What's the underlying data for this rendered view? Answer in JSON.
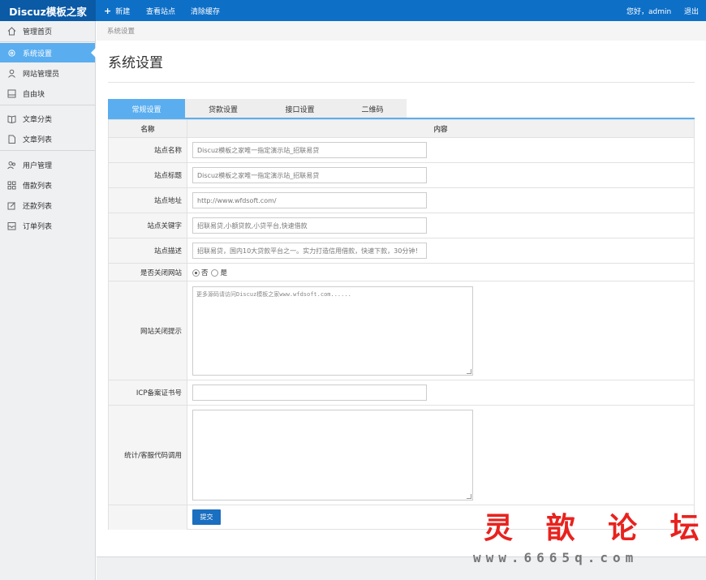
{
  "topbar": {
    "logo": "Discuz模板之家",
    "nav": {
      "new_label": "新建",
      "view_site_label": "查看站点",
      "clear_cache_label": "清除缓存"
    },
    "greeting": "您好，admin",
    "logout_label": "退出"
  },
  "sidebar": {
    "items": [
      {
        "label": "管理首页",
        "icon": "home-icon"
      },
      {
        "label": "系统设置",
        "icon": "gear-icon",
        "active": true
      },
      {
        "label": "网站管理员",
        "icon": "user-icon"
      },
      {
        "label": "自由块",
        "icon": "block-icon"
      },
      {
        "label": "文章分类",
        "icon": "book-icon"
      },
      {
        "label": "文章列表",
        "icon": "document-icon"
      },
      {
        "label": "用户管理",
        "icon": "users-icon"
      },
      {
        "label": "借款列表",
        "icon": "grid-icon"
      },
      {
        "label": "还款列表",
        "icon": "edit-icon"
      },
      {
        "label": "订单列表",
        "icon": "inbox-icon"
      }
    ]
  },
  "breadcrumb": "系统设置",
  "page_title": "系统设置",
  "tabs": [
    {
      "label": "常规设置",
      "active": true
    },
    {
      "label": "贷款设置"
    },
    {
      "label": "接口设置"
    },
    {
      "label": "二维码"
    }
  ],
  "table": {
    "header_name": "名称",
    "header_content": "内容",
    "fields": {
      "site_name": {
        "label": "站点名称",
        "value": "Discuz模板之家唯一指定演示站_招联易贷"
      },
      "site_title": {
        "label": "站点标题",
        "value": "Discuz模板之家唯一指定演示站_招联易贷"
      },
      "site_url": {
        "label": "站点地址",
        "value": "http://www.wfdsoft.com/"
      },
      "site_keywords": {
        "label": "站点关键字",
        "value": "招联易贷,小额贷款,小贷平台,快速借款"
      },
      "site_description": {
        "label": "站点描述",
        "value": "招联易贷，国内10大贷款平台之一。实力打造信用借款，快速下款，30分钟！"
      },
      "close_site": {
        "label": "是否关闭网站",
        "option_no": "否",
        "option_yes": "是",
        "selected": "否"
      },
      "close_notice": {
        "label": "网站关闭提示",
        "value": "更多源码请访问Discuz模板之家www.wfdsoft.com......"
      },
      "icp": {
        "label": "ICP备案证书号",
        "value": ""
      },
      "stats_code": {
        "label": "统计/客服代码调用",
        "value": ""
      }
    },
    "submit_label": "提交"
  },
  "watermark": {
    "title": "灵 歆 论 坛",
    "url": "www.6665q.com",
    "color": "#e8221e"
  },
  "colors": {
    "topbar": "#0e6fc7",
    "accent": "#5aaef0",
    "submit": "#1a6fc0"
  }
}
